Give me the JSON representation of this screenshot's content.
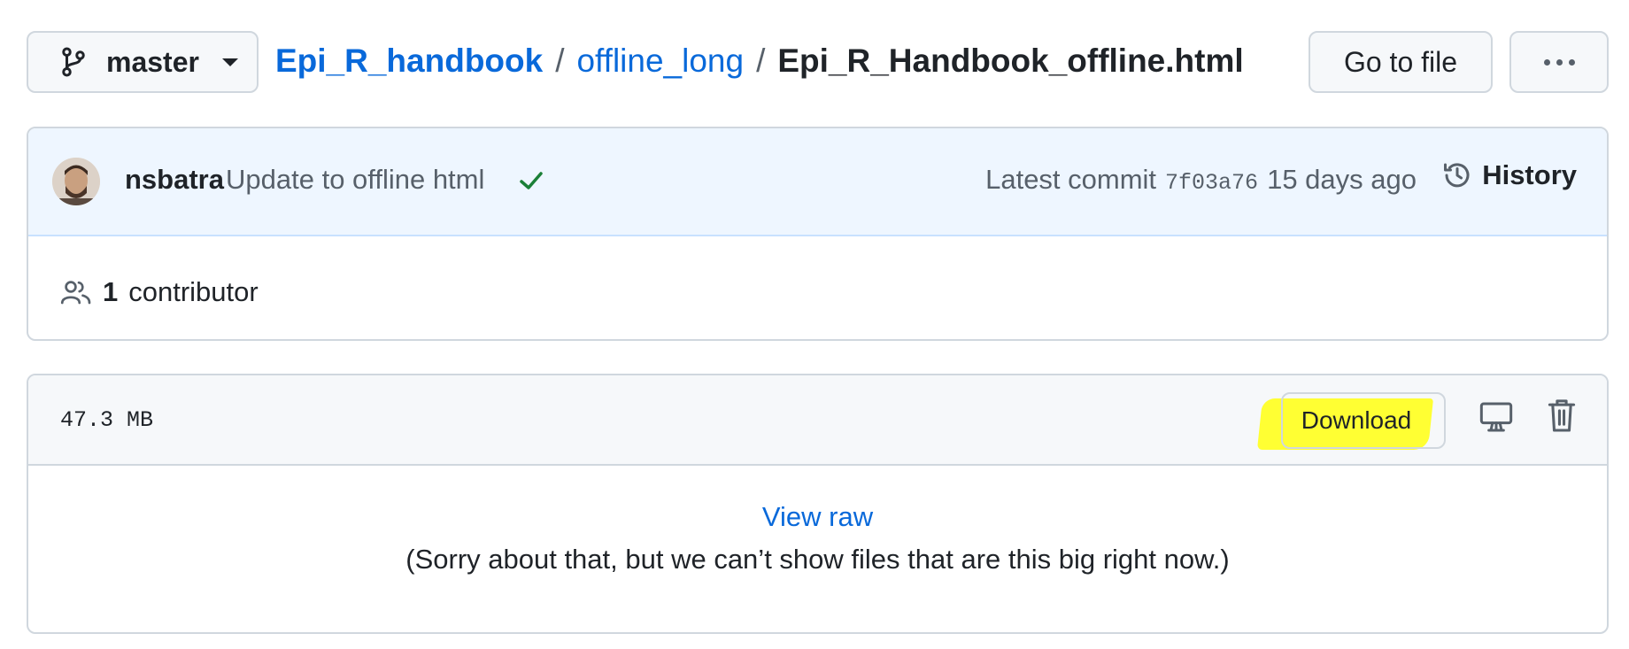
{
  "header": {
    "branch_label": "master",
    "breadcrumb": {
      "repo": "Epi_R_handbook",
      "folder": "offline_long",
      "file": "Epi_R_Handbook_offline.html",
      "separator": "/"
    },
    "goto_file_label": "Go to file"
  },
  "commit": {
    "author": "nsbatra",
    "message": "Update to offline html",
    "latest_label": "Latest commit",
    "sha": "7f03a76",
    "time": "15 days ago",
    "history_label": "History"
  },
  "contributors": {
    "count": "1",
    "label": "contributor"
  },
  "file": {
    "size": "47.3 MB",
    "download_label": "Download",
    "view_raw_label": "View raw",
    "message": "(Sorry about that, but we can’t show files that are this big right now.)"
  },
  "colors": {
    "link": "#0969da",
    "success": "#1a7f37",
    "highlight": "#ffff33",
    "commit_bg": "#eef6ff"
  }
}
